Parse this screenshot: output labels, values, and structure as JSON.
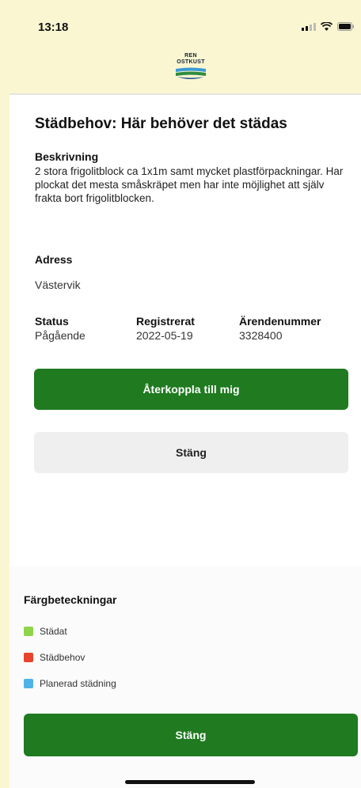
{
  "status_bar": {
    "time": "13:18"
  },
  "header": {
    "logo_text_line1": "REN",
    "logo_text_line2": "OSTKUST"
  },
  "report": {
    "title": "Städbehov: Här behöver det städas",
    "description_label": "Beskrivning",
    "description": "2 stora frigolitblock ca 1x1m samt mycket plastförpackningar. Har plockat det mesta småskräpet men har inte möjlighet att själv frakta bort frigolitblocken.",
    "address_label": "Adress",
    "address": "Västervik",
    "status_label": "Status",
    "status_value": "Pågående",
    "registered_label": "Registrerat",
    "registered_value": "2022-05-19",
    "case_number_label": "Ärendenummer",
    "case_number_value": "3328400",
    "feedback_button": "Återkoppla till mig",
    "close_button": "Stäng"
  },
  "legend": {
    "title": "Färgbeteckningar",
    "items": [
      {
        "label": "Städat",
        "color": "#8fd44a"
      },
      {
        "label": "Städbehov",
        "color": "#e8432c"
      },
      {
        "label": "Planerad städning",
        "color": "#4fb3e8"
      }
    ],
    "close_button": "Stäng"
  },
  "colors": {
    "primary_green": "#1f7a20",
    "background_cream": "#fbf6d2"
  }
}
